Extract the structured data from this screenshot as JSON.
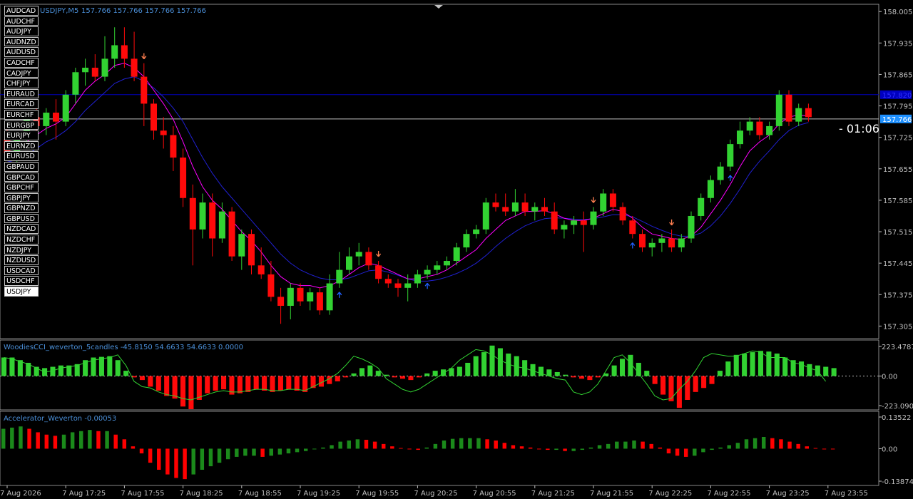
{
  "header": {
    "symbol_tf": "USDJPY,M5",
    "ohlc": "157.766 157.766 157.766 157.766"
  },
  "symbols": [
    "AUDCAD",
    "AUDCHF",
    "AUDJPY",
    "AUDNZD",
    "AUDUSD",
    "CADCHF",
    "CADJPY",
    "CHFJPY",
    "EURAUD",
    "EURCAD",
    "EURCHF",
    "EURGBP",
    "EURJPY",
    "EURNZD",
    "EURUSD",
    "GBPAUD",
    "GBPCAD",
    "GBPCHF",
    "GBPJPY",
    "GBPNZD",
    "GBPUSD",
    "NZDCAD",
    "NZDCHF",
    "NZDJPY",
    "NZDUSD",
    "USDCAD",
    "USDCHF",
    "USDJPY"
  ],
  "active_symbol": "USDJPY",
  "countdown": "- 01:06",
  "indicators": {
    "cci_label": "WoodiesCCI_weverton_5candles -45.8150 54.6633 54.6633 0.0000",
    "ac_label": "Accelerator_Weverton -0.00053"
  },
  "colors": {
    "background": "#000000",
    "bull": "#32d232",
    "bear": "#ff0a0a",
    "ma_fast": "#ff00ff",
    "ma_slow": "#2020d0",
    "price_axis": "#c0c0c0",
    "hline_bid": "#c0c0c0",
    "hline_level": "#0000c0",
    "ac_up": "#1b8a1b",
    "ac_down": "#ff0000"
  },
  "chart_data": [
    {
      "type": "candlestick",
      "title": "USDJPY,M5",
      "y_ticks": [
        "158.005",
        "157.935",
        "157.865",
        "157.795",
        "157.725",
        "157.655",
        "157.585",
        "157.515",
        "157.445",
        "157.375",
        "157.305"
      ],
      "ylim": [
        157.285,
        158.018
      ],
      "current_price": "157.766",
      "level_line": "157.820",
      "x_tick_labels": [
        "7 Aug 2026",
        "7 Aug 17:25",
        "7 Aug 17:55",
        "7 Aug 18:25",
        "7 Aug 18:55",
        "7 Aug 19:25",
        "7 Aug 19:55",
        "7 Aug 20:25",
        "7 Aug 20:55",
        "7 Aug 21:25",
        "7 Aug 21:55",
        "7 Aug 22:25",
        "7 Aug 22:55",
        "7 Aug 23:25",
        "7 Aug 23:55"
      ],
      "x_tick_candle_index": [
        0,
        6,
        12,
        18,
        24,
        30,
        36,
        42,
        48,
        54,
        60,
        66,
        72,
        78,
        84
      ],
      "ohlc": [
        [
          157.72,
          157.76,
          157.68,
          157.69
        ],
        [
          157.69,
          157.73,
          157.67,
          157.72
        ],
        [
          157.72,
          157.78,
          157.71,
          157.77
        ],
        [
          157.77,
          157.8,
          157.74,
          157.75
        ],
        [
          157.75,
          157.79,
          157.73,
          157.78
        ],
        [
          157.78,
          157.81,
          157.72,
          157.76
        ],
        [
          157.76,
          157.83,
          157.75,
          157.82
        ],
        [
          157.82,
          157.88,
          157.8,
          157.87
        ],
        [
          157.87,
          157.9,
          157.84,
          157.88
        ],
        [
          157.88,
          157.91,
          157.85,
          157.86
        ],
        [
          157.86,
          157.95,
          157.85,
          157.9
        ],
        [
          157.9,
          157.97,
          157.88,
          157.93
        ],
        [
          157.93,
          157.97,
          157.88,
          157.9
        ],
        [
          157.9,
          157.96,
          157.85,
          157.86
        ],
        [
          157.86,
          157.89,
          157.75,
          157.8
        ],
        [
          157.8,
          157.81,
          157.72,
          157.74
        ],
        [
          157.74,
          157.77,
          157.7,
          157.73
        ],
        [
          157.73,
          157.75,
          157.65,
          157.68
        ],
        [
          157.68,
          157.7,
          157.57,
          157.59
        ],
        [
          157.59,
          157.62,
          157.44,
          157.52
        ],
        [
          157.52,
          157.6,
          157.5,
          157.58
        ],
        [
          157.58,
          157.6,
          157.46,
          157.5
        ],
        [
          157.5,
          157.58,
          157.49,
          157.56
        ],
        [
          157.56,
          157.57,
          157.45,
          157.46
        ],
        [
          157.46,
          157.52,
          157.43,
          157.51
        ],
        [
          157.51,
          157.52,
          157.42,
          157.44
        ],
        [
          157.44,
          157.48,
          157.41,
          157.42
        ],
        [
          157.42,
          157.45,
          157.36,
          157.37
        ],
        [
          157.37,
          157.39,
          157.31,
          157.35
        ],
        [
          157.35,
          157.4,
          157.32,
          157.39
        ],
        [
          157.39,
          157.4,
          157.35,
          157.36
        ],
        [
          157.36,
          157.39,
          157.34,
          157.38
        ],
        [
          157.38,
          157.39,
          157.33,
          157.34
        ],
        [
          157.34,
          157.42,
          157.33,
          157.4
        ],
        [
          157.4,
          157.47,
          157.39,
          157.43
        ],
        [
          157.43,
          157.48,
          157.42,
          157.46
        ],
        [
          157.46,
          157.49,
          157.44,
          157.47
        ],
        [
          157.47,
          157.48,
          157.43,
          157.44
        ],
        [
          157.44,
          157.45,
          157.4,
          157.41
        ],
        [
          157.41,
          157.42,
          157.39,
          157.4
        ],
        [
          157.4,
          157.41,
          157.37,
          157.39
        ],
        [
          157.39,
          157.42,
          157.36,
          157.4
        ],
        [
          157.4,
          157.43,
          157.39,
          157.42
        ],
        [
          157.42,
          157.44,
          157.41,
          157.43
        ],
        [
          157.43,
          157.45,
          157.42,
          157.44
        ],
        [
          157.44,
          157.46,
          157.43,
          157.45
        ],
        [
          157.45,
          157.49,
          157.44,
          157.48
        ],
        [
          157.48,
          157.52,
          157.47,
          157.51
        ],
        [
          157.51,
          157.53,
          157.5,
          157.52
        ],
        [
          157.52,
          157.59,
          157.51,
          157.58
        ],
        [
          157.58,
          157.6,
          157.56,
          157.57
        ],
        [
          157.57,
          157.6,
          157.55,
          157.56
        ],
        [
          157.56,
          157.61,
          157.55,
          157.58
        ],
        [
          157.58,
          157.6,
          157.55,
          157.56
        ],
        [
          157.56,
          157.58,
          157.54,
          157.57
        ],
        [
          157.57,
          157.59,
          157.55,
          157.56
        ],
        [
          157.56,
          157.58,
          157.51,
          157.52
        ],
        [
          157.52,
          157.54,
          157.5,
          157.53
        ],
        [
          157.53,
          157.55,
          157.51,
          157.54
        ],
        [
          157.54,
          157.56,
          157.47,
          157.53
        ],
        [
          157.53,
          157.57,
          157.52,
          157.56
        ],
        [
          157.56,
          157.61,
          157.55,
          157.6
        ],
        [
          157.6,
          157.61,
          157.56,
          157.57
        ],
        [
          157.57,
          157.58,
          157.53,
          157.54
        ],
        [
          157.54,
          157.55,
          157.5,
          157.51
        ],
        [
          157.51,
          157.52,
          157.47,
          157.48
        ],
        [
          157.48,
          157.5,
          157.46,
          157.49
        ],
        [
          157.49,
          157.51,
          157.47,
          157.5
        ],
        [
          157.5,
          157.52,
          157.47,
          157.48
        ],
        [
          157.48,
          157.51,
          157.47,
          157.5
        ],
        [
          157.5,
          157.56,
          157.49,
          157.55
        ],
        [
          157.55,
          157.6,
          157.54,
          157.59
        ],
        [
          157.59,
          157.64,
          157.58,
          157.63
        ],
        [
          157.63,
          157.67,
          157.62,
          157.66
        ],
        [
          157.66,
          157.72,
          157.65,
          157.71
        ],
        [
          157.71,
          157.76,
          157.7,
          157.74
        ],
        [
          157.74,
          157.77,
          157.73,
          157.76
        ],
        [
          157.76,
          157.77,
          157.72,
          157.73
        ],
        [
          157.73,
          157.76,
          157.72,
          157.75
        ],
        [
          157.75,
          157.83,
          157.74,
          157.82
        ],
        [
          157.82,
          157.83,
          157.75,
          157.76
        ],
        [
          157.76,
          157.8,
          157.75,
          157.79
        ],
        [
          157.79,
          157.8,
          157.76,
          157.77
        ]
      ],
      "ma_fast": [
        157.7,
        157.7,
        157.715,
        157.73,
        157.745,
        157.755,
        157.77,
        157.8,
        157.83,
        157.85,
        157.865,
        157.885,
        157.89,
        157.88,
        157.86,
        157.83,
        157.8,
        157.765,
        157.715,
        157.66,
        157.615,
        157.585,
        157.565,
        157.54,
        157.515,
        157.495,
        157.47,
        157.44,
        157.415,
        157.4,
        157.395,
        157.395,
        157.39,
        157.395,
        157.405,
        157.42,
        157.435,
        157.445,
        157.44,
        157.43,
        157.42,
        157.41,
        157.41,
        157.415,
        157.42,
        157.43,
        157.445,
        157.46,
        157.475,
        157.5,
        157.52,
        157.54,
        157.55,
        157.56,
        157.56,
        157.562,
        157.555,
        157.545,
        157.54,
        157.54,
        157.545,
        157.555,
        157.565,
        157.56,
        157.545,
        157.525,
        157.51,
        157.505,
        157.5,
        157.498,
        157.505,
        157.525,
        157.555,
        157.585,
        157.62,
        157.66,
        157.695,
        157.715,
        157.73,
        157.755,
        157.77,
        157.775,
        157.772
      ],
      "ma_slow": [
        157.67,
        157.675,
        157.685,
        157.7,
        157.715,
        157.725,
        157.74,
        157.76,
        157.785,
        157.805,
        157.825,
        157.845,
        157.855,
        157.86,
        157.85,
        157.835,
        157.815,
        157.79,
        157.76,
        157.72,
        157.68,
        157.645,
        157.615,
        157.59,
        157.565,
        157.54,
        157.515,
        157.49,
        157.465,
        157.445,
        157.43,
        157.42,
        157.412,
        157.408,
        157.408,
        157.412,
        157.42,
        157.428,
        157.43,
        157.425,
        157.418,
        157.41,
        157.405,
        157.405,
        157.408,
        157.414,
        157.422,
        157.432,
        157.445,
        157.462,
        157.482,
        157.5,
        157.515,
        157.528,
        157.537,
        157.544,
        157.546,
        157.545,
        157.543,
        157.542,
        157.544,
        157.548,
        157.553,
        157.553,
        157.548,
        157.538,
        157.527,
        157.518,
        157.51,
        157.505,
        157.505,
        157.512,
        157.528,
        157.55,
        157.578,
        157.61,
        157.645,
        157.672,
        157.695,
        157.72,
        157.74,
        157.752,
        157.758
      ],
      "arrows_down_at": [
        14,
        38,
        60,
        68
      ],
      "arrows_up_at": [
        34,
        43,
        64,
        74
      ]
    },
    {
      "type": "bar",
      "title": "WoodiesCCI_weverton_5candles",
      "y_ticks": [
        "223.4787",
        "0.00",
        "-223.0902"
      ],
      "ylim": [
        -223.0902,
        223.4787
      ],
      "values": [
        140,
        140,
        120,
        100,
        70,
        60,
        70,
        80,
        80,
        90,
        120,
        140,
        145,
        150,
        120,
        40,
        -10,
        -30,
        -80,
        -110,
        -150,
        -170,
        -230,
        -250,
        -180,
        -130,
        -110,
        -100,
        -140,
        -130,
        -120,
        -100,
        -110,
        -120,
        -110,
        -100,
        -110,
        -120,
        -90,
        -80,
        -60,
        -40,
        -10,
        20,
        60,
        80,
        40,
        10,
        -10,
        -20,
        -30,
        -10,
        20,
        40,
        50,
        60,
        70,
        100,
        150,
        180,
        230,
        210,
        170,
        150,
        120,
        90,
        70,
        50,
        30,
        10,
        -10,
        -20,
        -30,
        -10,
        20,
        80,
        130,
        160,
        100,
        40,
        -60,
        -140,
        -190,
        -240,
        -180,
        -120,
        -90,
        -60,
        40,
        110,
        160,
        170,
        180,
        190,
        185,
        170,
        140,
        120,
        110,
        90,
        80,
        70,
        60
      ],
      "signal": [
        140,
        130,
        110,
        90,
        60,
        30,
        40,
        60,
        70,
        80,
        100,
        120,
        130,
        140,
        160,
        80,
        -40,
        -80,
        -90,
        -120,
        -140,
        -150,
        -170,
        -180,
        -160,
        -140,
        -120,
        -110,
        -120,
        -120,
        -110,
        -100,
        -100,
        -110,
        -110,
        -100,
        -100,
        -110,
        -80,
        -50,
        -20,
        20,
        80,
        150,
        130,
        100,
        60,
        -20,
        -60,
        -100,
        -120,
        -100,
        -60,
        -20,
        20,
        60,
        120,
        160,
        200,
        190,
        160,
        120,
        90,
        70,
        60,
        40,
        20,
        0,
        -20,
        -30,
        -120,
        -140,
        -120,
        -60,
        40,
        140,
        160,
        100,
        20,
        -60,
        -150,
        -180,
        -170,
        -100,
        -40,
        40,
        140,
        170,
        160,
        150,
        150,
        170,
        190,
        180,
        140,
        140,
        140,
        100,
        90,
        60,
        40,
        -40
      ]
    },
    {
      "type": "bar",
      "title": "Accelerator_Weverton",
      "y_ticks": [
        "0.13522",
        "0.00",
        "-0.13874"
      ],
      "ylim": [
        -0.13874,
        0.13522
      ],
      "values": [
        0.085,
        0.09,
        0.095,
        0.085,
        0.07,
        0.06,
        0.055,
        0.06,
        0.07,
        0.075,
        0.08,
        0.075,
        0.075,
        0.06,
        0.04,
        0.01,
        -0.02,
        -0.06,
        -0.09,
        -0.11,
        -0.125,
        -0.13,
        -0.11,
        -0.09,
        -0.075,
        -0.06,
        -0.045,
        -0.035,
        -0.03,
        -0.03,
        -0.035,
        -0.03,
        -0.025,
        -0.02,
        -0.015,
        -0.01,
        0.0,
        0.005,
        0.015,
        0.03,
        0.035,
        0.04,
        0.038,
        0.03,
        0.02,
        0.01,
        0.003,
        -0.003,
        -0.005,
        0.005,
        0.02,
        0.035,
        0.042,
        0.045,
        0.045,
        0.045,
        0.04,
        0.035,
        0.025,
        0.015,
        0.01,
        0.005,
        0.0,
        -0.005,
        -0.005,
        -0.01,
        -0.01,
        -0.005,
        0.005,
        0.015,
        0.02,
        0.03,
        0.03,
        0.035,
        0.03,
        0.02,
        0.005,
        -0.02,
        -0.03,
        -0.035,
        -0.03,
        -0.015,
        -0.005,
        0.005,
        0.015,
        0.025,
        0.04,
        0.045,
        0.05,
        0.045,
        0.04,
        0.03,
        0.02,
        0.01,
        0.003,
        0.0,
        -0.002
      ]
    }
  ]
}
